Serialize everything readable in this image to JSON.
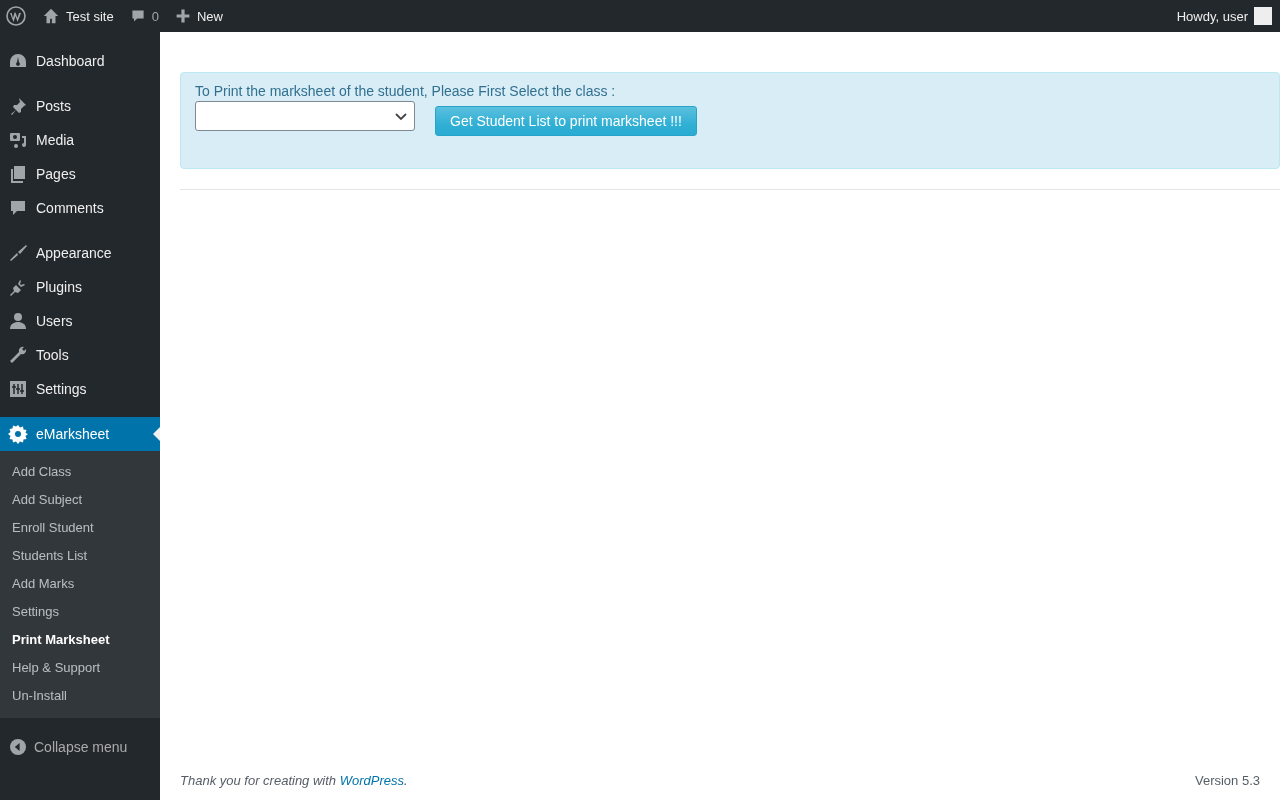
{
  "admin_bar": {
    "site_name": "Test site",
    "comments_count": "0",
    "new_label": "New",
    "greeting": "Howdy, user"
  },
  "sidebar": {
    "groups": [
      [
        {
          "label": "Dashboard",
          "selected": false
        }
      ],
      [
        {
          "label": "Posts",
          "selected": false
        },
        {
          "label": "Media",
          "selected": false
        },
        {
          "label": "Pages",
          "selected": false
        },
        {
          "label": "Comments",
          "selected": false
        }
      ],
      [
        {
          "label": "Appearance",
          "selected": false
        },
        {
          "label": "Plugins",
          "selected": false
        },
        {
          "label": "Users",
          "selected": false
        },
        {
          "label": "Tools",
          "selected": false
        },
        {
          "label": "Settings",
          "selected": false
        }
      ],
      [
        {
          "label": "eMarksheet",
          "selected": true,
          "children": [
            {
              "label": "Add Class",
              "selected": false
            },
            {
              "label": "Add Subject",
              "selected": false
            },
            {
              "label": "Enroll Student",
              "selected": false
            },
            {
              "label": "Students List",
              "selected": false
            },
            {
              "label": "Add Marks",
              "selected": false
            },
            {
              "label": "Settings",
              "selected": false
            },
            {
              "label": "Print Marksheet",
              "selected": true
            },
            {
              "label": "Help & Support",
              "selected": false
            },
            {
              "label": "Un-Install",
              "selected": false
            }
          ]
        }
      ]
    ],
    "collapse_label": "Collapse menu"
  },
  "notice": {
    "prompt": "To Print the marksheet of the student, Please First Select the class :",
    "button": "Get Student List to print marksheet !!!"
  },
  "footer": {
    "thanks_before": "Thank you for creating with",
    "link": "WordPress",
    "thanks_after": ".",
    "version": "Version 5.3"
  }
}
